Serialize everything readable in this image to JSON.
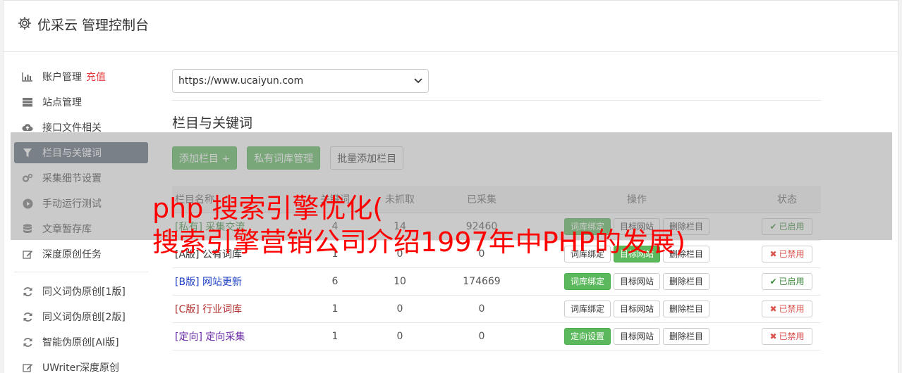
{
  "header": {
    "title": "优采云 管理控制台",
    "icon": "gear-icon"
  },
  "sidebar": {
    "items": [
      {
        "label": "账户管理",
        "extra": "充值",
        "icon": "bar-chart-icon"
      },
      {
        "label": "站点管理",
        "icon": "server-icon"
      },
      {
        "label": "接口文件相关",
        "icon": "cloud-upload-icon"
      },
      {
        "label": "栏目与关键词",
        "icon": "filter-icon",
        "active": true
      },
      {
        "label": "采集细节设置",
        "icon": "cogs-icon"
      },
      {
        "label": "手动运行测试",
        "icon": "play-circle-icon"
      },
      {
        "label": "文章暂存库",
        "icon": "database-icon"
      },
      {
        "label": "深度原创任务",
        "icon": "edit-icon"
      }
    ],
    "items2": [
      {
        "label": "同义词伪原创[1版]",
        "icon": "refresh-icon"
      },
      {
        "label": "同义词伪原创[2版]",
        "icon": "refresh-icon"
      },
      {
        "label": "智能伪原创[AI版]",
        "icon": "refresh-icon"
      },
      {
        "label": "UWriter深度原创",
        "icon": "edit-icon"
      }
    ]
  },
  "site_select": {
    "value": "https://www.ucaiyun.com"
  },
  "section_title": "栏目与关键词",
  "toolbar": {
    "add_column": "添加栏目 +",
    "private_lib": "私有词库管理",
    "batch_add": "批量添加栏目"
  },
  "table": {
    "headers": [
      "栏目名称",
      "关键词",
      "未抓取",
      "已采集",
      "操作",
      "状态"
    ],
    "rows": [
      {
        "tag": "[私有]",
        "name": "采集交流",
        "kw": "4",
        "pending": "14",
        "collected": "92460",
        "bind_label": "词库绑定",
        "bind_green": true,
        "status": "已启用",
        "on": true
      },
      {
        "tag": "[A版]",
        "name": "公有词库",
        "kw": "1",
        "pending": "0",
        "collected": "0",
        "bind_label": "词库绑定",
        "bind_green": false,
        "status": "已禁用",
        "on": false
      },
      {
        "tag": "[B版]",
        "name": "网站更新",
        "kw": "6",
        "pending": "10",
        "collected": "174669",
        "bind_label": "词库绑定",
        "bind_green": true,
        "status": "已启用",
        "on": true
      },
      {
        "tag": "[C版]",
        "name": "行业词库",
        "kw": "1",
        "pending": "0",
        "collected": "0",
        "bind_label": "词库绑定",
        "bind_green": false,
        "status": "已禁用",
        "on": false
      },
      {
        "tag": "[定向]",
        "name": "定向采集",
        "kw": "1",
        "pending": "0",
        "collected": "0",
        "bind_label": "定向设置",
        "bind_green": true,
        "status": "已禁用",
        "on": false
      }
    ],
    "target_label": "目标网站",
    "delete_label": "删除栏目"
  },
  "overlay_text": {
    "line1": "php 搜索引擎优化(",
    "line2": "搜索引擎营销公司介绍1997年中PHP的发展)"
  },
  "colors": {
    "accent_green": "#5cb85c",
    "sidebar_active": "#5f6a7b",
    "overlay_red": "#ff0000"
  }
}
